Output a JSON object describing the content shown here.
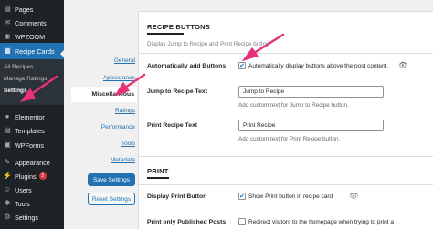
{
  "wp_menu": {
    "items": [
      {
        "label": "Pages",
        "icon": "pages-icon",
        "glyph": "▤"
      },
      {
        "label": "Comments",
        "icon": "comments-icon",
        "glyph": "✉"
      },
      {
        "label": "WPZOOM",
        "icon": "wpzoom-icon",
        "glyph": "◉"
      },
      {
        "label": "Recipe Cards",
        "icon": "recipe-cards-icon",
        "glyph": "▦"
      },
      {
        "label": "Elementor",
        "icon": "elementor-icon",
        "glyph": "●"
      },
      {
        "label": "Templates",
        "icon": "templates-icon",
        "glyph": "▤"
      },
      {
        "label": "WPForms",
        "icon": "wpforms-icon",
        "glyph": "▣"
      },
      {
        "label": "Appearance",
        "icon": "appearance-icon",
        "glyph": "✎"
      },
      {
        "label": "Plugins",
        "icon": "plugins-icon",
        "glyph": "⚡",
        "badge": "3"
      },
      {
        "label": "Users",
        "icon": "users-icon",
        "glyph": "☺"
      },
      {
        "label": "Tools",
        "icon": "tools-icon",
        "glyph": "✱"
      },
      {
        "label": "Settings",
        "icon": "settings-icon",
        "glyph": "⚙"
      }
    ],
    "submenu": [
      "All Recipes",
      "Manage Ratings",
      "Settings"
    ]
  },
  "settings_nav": {
    "links": [
      "General",
      "Appearance",
      "Ratings",
      "Performance",
      "Tools",
      "Metadata"
    ],
    "active": "Miscellaneous",
    "save_button": "Save Settings",
    "reset_button": "Reset Settings"
  },
  "recipe_buttons": {
    "title": "RECIPE BUTTONS",
    "description": "Display Jump to Recipe and Print Recipe button",
    "auto_add": {
      "label": "Automatically add Buttons",
      "checked": true,
      "text": "Automatically display buttons above the post content."
    },
    "jump": {
      "label": "Jump to Recipe Text",
      "value": "Jump to Recipe",
      "help": "Add custom text for Jump to Recipe button."
    },
    "print": {
      "label": "Print Recipe Text",
      "value": "Print Recipe",
      "help": "Add custom text for Print Recipe button."
    }
  },
  "print_section": {
    "title": "PRINT",
    "display_print": {
      "label": "Display Print Button",
      "checked": true,
      "text": "Show Print button in recipe card"
    },
    "published_only": {
      "label": "Print only Published Posts",
      "checked": false,
      "text": "Redirect visitors to the homepage when trying to print a"
    }
  },
  "colors": {
    "admin_bar": "#1d2327",
    "accent": "#2271b1",
    "annotation": "#e8317a"
  }
}
